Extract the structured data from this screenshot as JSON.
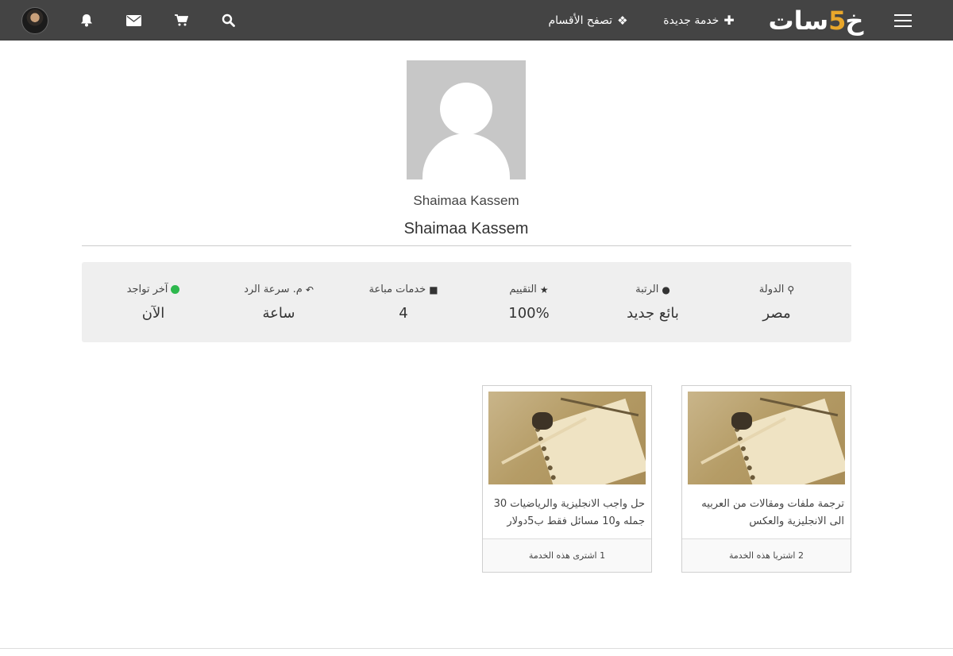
{
  "navbar": {
    "logo_text": "خمسات",
    "logo_five": "5",
    "new_service_label": "خدمة جديدة",
    "browse_categories_label": "تصفح الأقسام",
    "icons": [
      "hamburger-icon",
      "plus-icon",
      "categories-icon",
      "search-icon",
      "cart-icon",
      "mail-icon",
      "bell-icon"
    ]
  },
  "profile": {
    "username": "Shaimaa Kassem",
    "display_name": "Shaimaa Kassem"
  },
  "stats": [
    {
      "label": "الدولة",
      "value": "مصر",
      "icon": "map-marker-icon"
    },
    {
      "label": "الرتبة",
      "value": "بائع جديد",
      "icon": "user-icon"
    },
    {
      "label": "التقييم",
      "value": "100%",
      "icon": "star-icon"
    },
    {
      "label": "خدمات مباعة",
      "value": "4",
      "icon": "truck-icon"
    },
    {
      "label": "م. سرعة الرد",
      "value": "ساعة",
      "icon": "reply-icon"
    },
    {
      "label": "آخر تواجد",
      "value": "الآن",
      "icon": "online-dot-icon"
    }
  ],
  "services": [
    {
      "title": "ترجمة ملفات ومقالات من العربيه الى الانجليزية والعكس",
      "purchases": "2 اشتريا هذه الخدمة"
    },
    {
      "title": "حل واجب الانجليزية والرياضيات 30 جمله و10 مسائل فقط ب5دولار",
      "purchases": "1 اشترى هذه الخدمة"
    }
  ],
  "colors": {
    "navbar": "#444444",
    "logo_accent": "#e9a72b",
    "online": "#2db84d",
    "stats_bg": "#efefef"
  }
}
